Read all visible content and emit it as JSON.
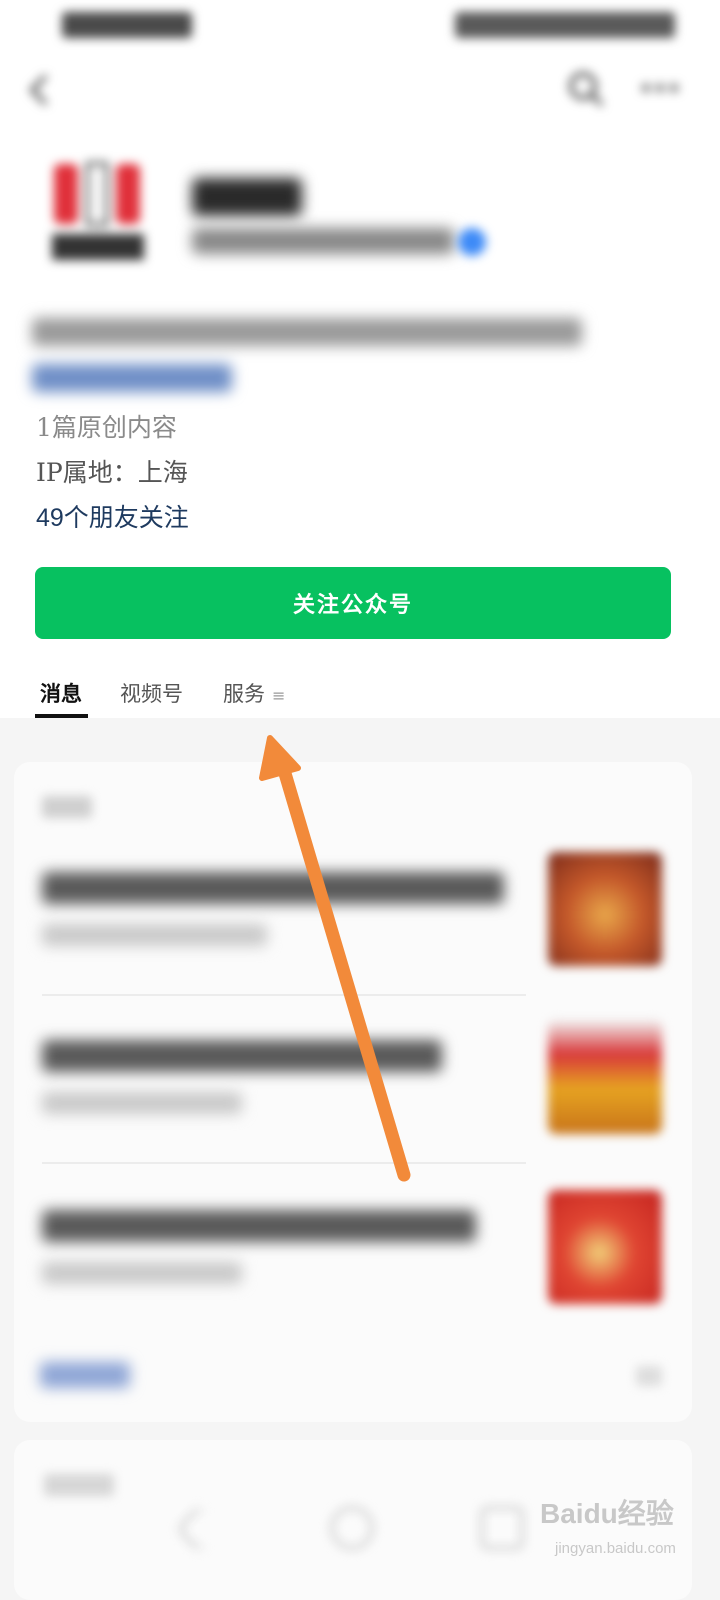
{
  "profile": {
    "original_count": "1篇原创内容",
    "ip_location": "IP属地：上海",
    "friends_following": "49个朋友关注"
  },
  "follow_button": {
    "label": "关注公众号"
  },
  "tabs": [
    {
      "label": "消息",
      "active": true
    },
    {
      "label": "视频号",
      "active": false
    },
    {
      "label": "服务",
      "active": false
    }
  ],
  "icons": {
    "back": "back-icon",
    "search": "search-icon",
    "more": "more-icon",
    "verified": "verified-icon",
    "service_menu": "menu-icon"
  },
  "watermark": {
    "brand": "Baidu经验",
    "url": "jingyan.baidu.com"
  },
  "colors": {
    "follow_button": "#07c160",
    "friends_text": "#1e3a5f",
    "annotation_arrow": "#f28a3a"
  }
}
